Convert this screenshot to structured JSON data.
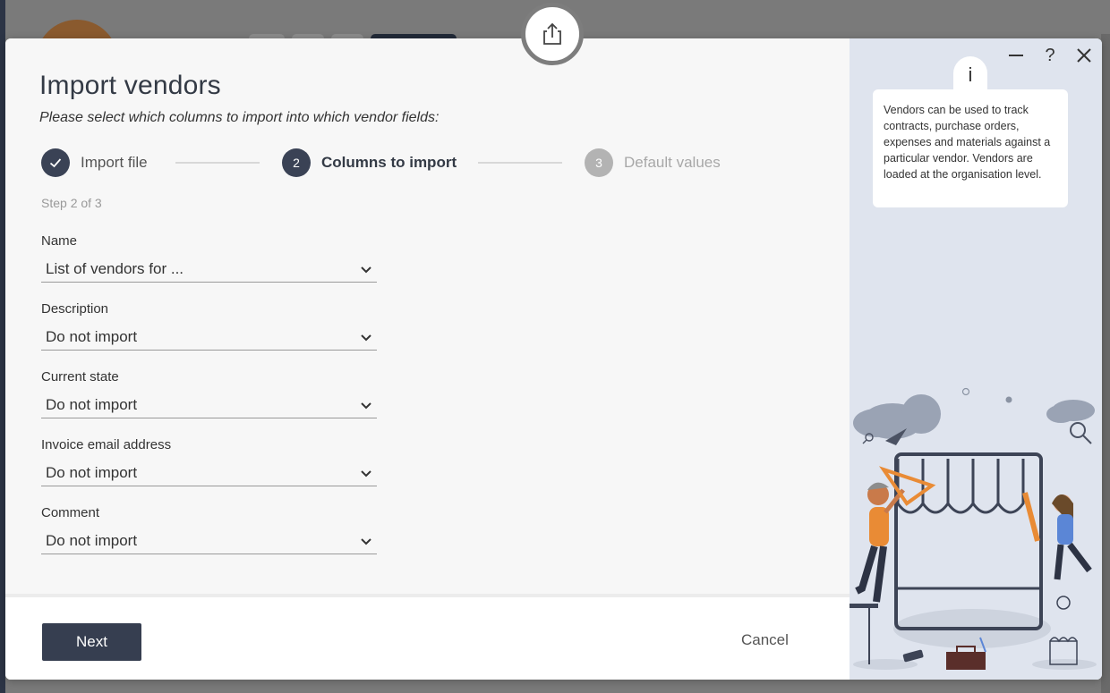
{
  "dialog": {
    "title": "Import vendors",
    "subtitle": "Please select which columns to import into which vendor fields:",
    "step_counter": "Step 2 of 3"
  },
  "stepper": {
    "steps": [
      {
        "number": "",
        "label": "Import file",
        "state": "done"
      },
      {
        "number": "2",
        "label": "Columns to import",
        "state": "active"
      },
      {
        "number": "3",
        "label": "Default values",
        "state": "todo"
      }
    ]
  },
  "fields": [
    {
      "label": "Name",
      "value": "List of vendors for ..."
    },
    {
      "label": "Description",
      "value": "Do not import"
    },
    {
      "label": "Current state",
      "value": "Do not import"
    },
    {
      "label": "Invoice email address",
      "value": "Do not import"
    },
    {
      "label": "Comment",
      "value": "Do not import"
    }
  ],
  "footer": {
    "next_label": "Next",
    "cancel_label": "Cancel"
  },
  "side_panel": {
    "info_icon": "i",
    "info_text": "Vendors can be used to track contracts, purchase orders, expenses and materials against a particular vendor. Vendors are loaded at the organisation level.",
    "help_label": "?"
  },
  "icons": {
    "export": "export-icon",
    "check": "check-icon",
    "chevron": "chevron-down-icon",
    "minimize": "minimize-icon",
    "close": "close-icon"
  },
  "colors": {
    "primary": "#363e50",
    "side_bg": "#dfe4ee",
    "accent_orange": "#e98b35"
  }
}
